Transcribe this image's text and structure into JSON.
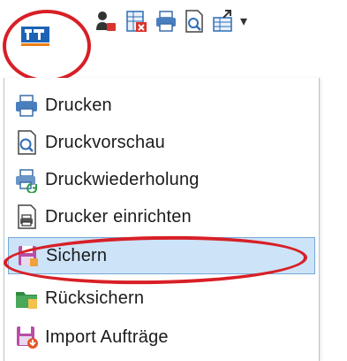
{
  "toolbar": {
    "icons": [
      "app-logo-icon",
      "user-permission-icon",
      "excel-export-icon",
      "printer-icon",
      "print-preview-icon",
      "import-icon",
      "customize-dropdown-icon"
    ],
    "customize_glyph": "▾"
  },
  "menu": {
    "items": [
      {
        "label": "Drucken",
        "icon": "printer-icon"
      },
      {
        "label": "Druckvorschau",
        "icon": "print-preview-icon"
      },
      {
        "label": "Druckwiederholung",
        "icon": "reprint-icon"
      },
      {
        "label": "Drucker einrichten",
        "icon": "printer-setup-icon"
      },
      {
        "label": "Sichern",
        "icon": "backup-icon",
        "selected": true
      },
      {
        "label": "Rücksichern",
        "icon": "restore-icon"
      },
      {
        "label": "Import Aufträge",
        "icon": "import-orders-icon"
      }
    ]
  },
  "colors": {
    "highlight": "#cde3f7",
    "highlight_border": "#76a9d8",
    "annotation_red": "#d81f26",
    "brand_blue": "#1d63b5",
    "brand_orange": "#f07d12"
  }
}
